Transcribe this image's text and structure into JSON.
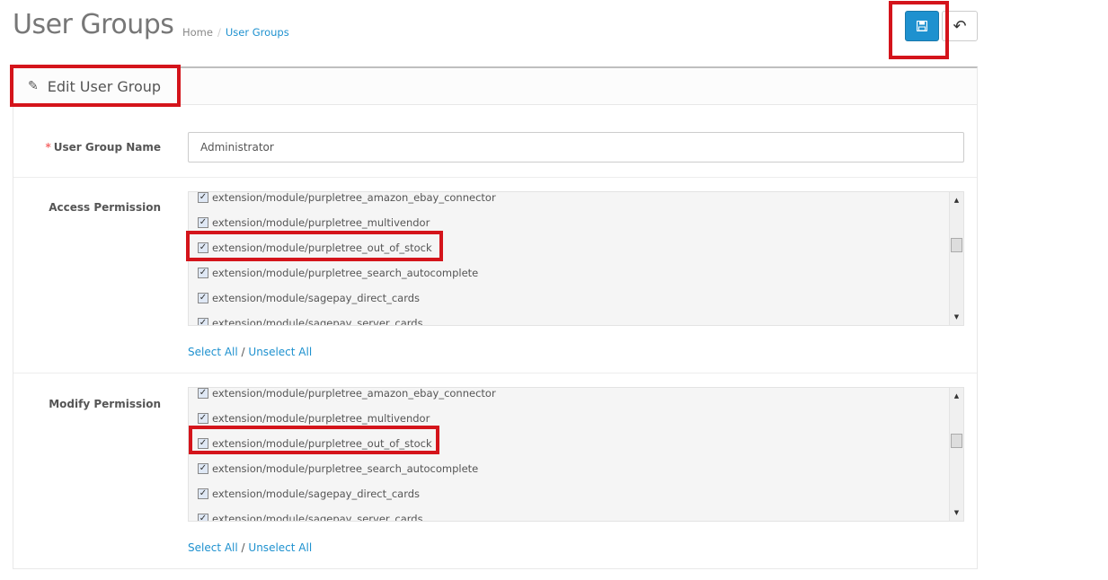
{
  "header": {
    "title": "User Groups",
    "breadcrumb": [
      {
        "label": "Home"
      },
      {
        "label": "User Groups"
      }
    ],
    "separator": "/"
  },
  "toolbar": {
    "save_icon": "floppy-disk-icon",
    "back_icon": "reply-arrow-icon",
    "back_glyph": "↶"
  },
  "panel": {
    "title": "Edit User Group",
    "icon": "pencil-icon",
    "icon_glyph": "✎"
  },
  "form": {
    "name_label": "User Group Name",
    "required_mark": "*",
    "name_value": "Administrator",
    "access": {
      "label": "Access Permission",
      "items": [
        "extension/module/purpletree_amazon_ebay_connector",
        "extension/module/purpletree_multivendor",
        "extension/module/purpletree_out_of_stock",
        "extension/module/purpletree_search_autocomplete",
        "extension/module/sagepay_direct_cards",
        "extension/module/sagepay_server_cards"
      ],
      "select_all": "Select All",
      "sep": "/",
      "unselect_all": "Unselect All"
    },
    "modify": {
      "label": "Modify Permission",
      "items": [
        "extension/module/purpletree_amazon_ebay_connector",
        "extension/module/purpletree_multivendor",
        "extension/module/purpletree_out_of_stock",
        "extension/module/purpletree_search_autocomplete",
        "extension/module/sagepay_direct_cards",
        "extension/module/sagepay_server_cards"
      ],
      "select_all": "Select All",
      "sep": "/",
      "unselect_all": "Unselect All"
    }
  },
  "colors": {
    "primary": "#1e91cf",
    "highlight": "#d4141b"
  }
}
